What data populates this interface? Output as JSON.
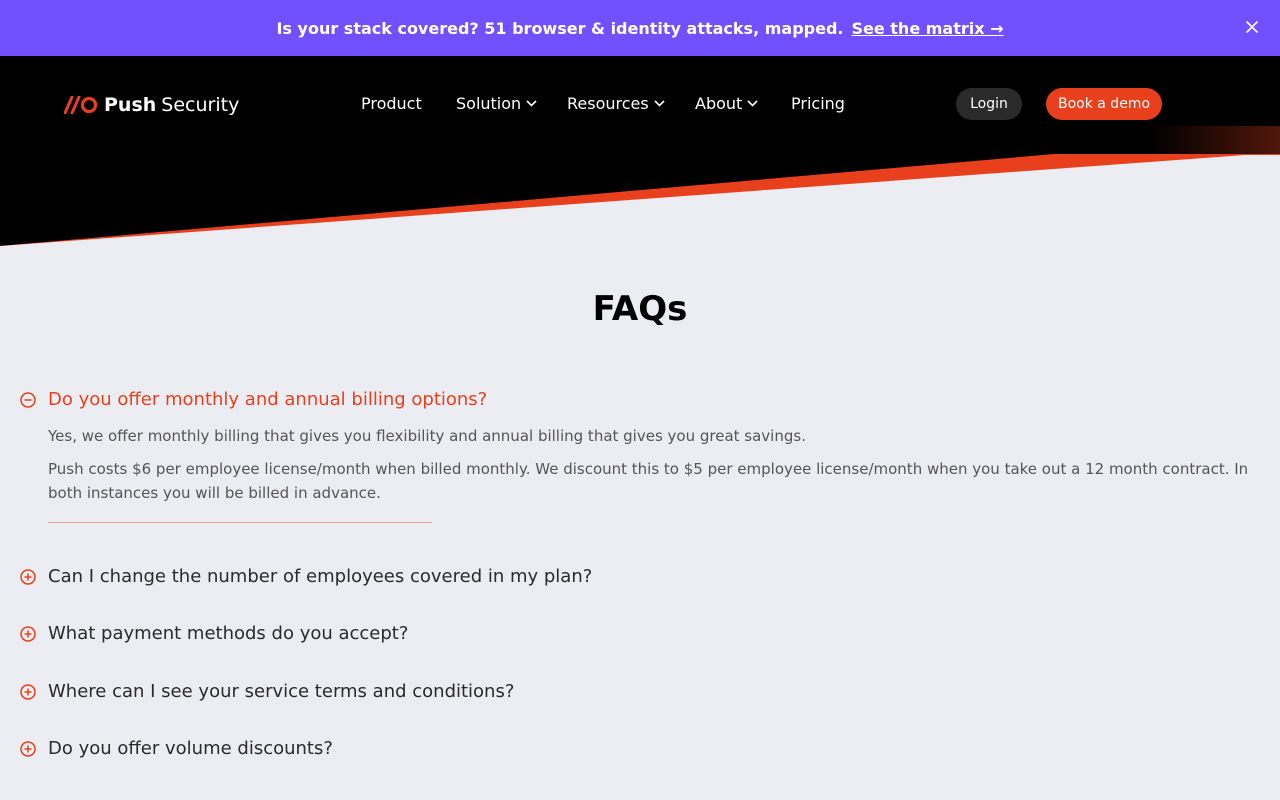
{
  "banner": {
    "text": "Is your stack covered? 51 browser & identity attacks, mapped.",
    "link": "See the matrix →",
    "close_icon": "close-icon"
  },
  "brand": {
    "bold": "Push",
    "light": "Security",
    "accent": "#E8401C"
  },
  "nav": {
    "items": [
      {
        "label": "Product",
        "dropdown": false
      },
      {
        "label": "Solution",
        "dropdown": true
      },
      {
        "label": "Resources",
        "dropdown": true
      },
      {
        "label": "About",
        "dropdown": true
      },
      {
        "label": "Pricing",
        "dropdown": false
      }
    ],
    "login": "Login",
    "demo": "Book a demo"
  },
  "faq": {
    "title": "FAQs",
    "items": [
      {
        "question": "Do you offer monthly and annual billing options?",
        "open": true,
        "answer": [
          "Yes, we offer monthly billing that gives you flexibility and annual billing that gives you great savings.",
          "Push costs $6 per employee license/month when billed monthly. We discount this to $5 per employee license/month when you take out a 12 month contract. In both instances you will be billed in advance."
        ]
      },
      {
        "question": "Can I change the number of employees covered in my plan?",
        "open": false
      },
      {
        "question": "What payment methods do you accept?",
        "open": false
      },
      {
        "question": "Where can I see your service terms and conditions?",
        "open": false
      },
      {
        "question": "Do you offer volume discounts?",
        "open": false
      }
    ]
  },
  "colors": {
    "banner_bg": "#7150FF",
    "header_bg": "#000000",
    "page_bg": "#ECECF3",
    "accent": "#E8401C"
  }
}
